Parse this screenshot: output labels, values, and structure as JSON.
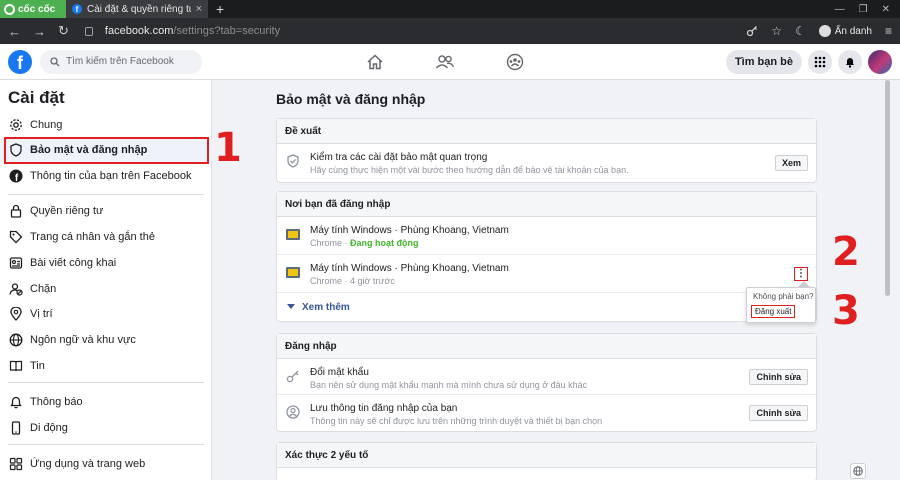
{
  "browser": {
    "brand": "cốc cốc",
    "tab_title": "Cài đặt & quyền riêng tư | Fa",
    "tab_close": "×",
    "new_tab": "+",
    "url_host": "facebook.com",
    "url_path": "/settings?tab=security",
    "incognito_label": "Ẩn danh",
    "window_controls": [
      "—",
      "❐",
      "✕"
    ]
  },
  "header": {
    "search_placeholder": "Tìm kiếm trên Facebook",
    "find_friends": "Tìm bạn bè"
  },
  "sidebar": {
    "title": "Cài đặt",
    "items": [
      {
        "label": "Chung",
        "icon": "gear-icon"
      },
      {
        "label": "Bảo mật và đăng nhập",
        "icon": "shield-icon",
        "active": true
      },
      {
        "label": "Thông tin của bạn trên Facebook",
        "icon": "facebook-icon"
      },
      {
        "label": "Quyền riêng tư",
        "icon": "lock-icon"
      },
      {
        "label": "Trang cá nhân và gắn thẻ",
        "icon": "tag-icon"
      },
      {
        "label": "Bài viết công khai",
        "icon": "public-posts-icon"
      },
      {
        "label": "Chặn",
        "icon": "block-icon"
      },
      {
        "label": "Vị trí",
        "icon": "location-pin-icon"
      },
      {
        "label": "Ngôn ngữ và khu vực",
        "icon": "globe-icon"
      },
      {
        "label": "Tin",
        "icon": "book-icon"
      },
      {
        "label": "Thông báo",
        "icon": "bell-icon"
      },
      {
        "label": "Di động",
        "icon": "mobile-icon"
      },
      {
        "label": "Ứng dụng và trang web",
        "icon": "apps-icon"
      }
    ]
  },
  "main": {
    "title": "Bảo mật và đăng nhập",
    "recommended": {
      "heading": "Đề xuất",
      "title": "Kiểm tra các cài đặt bảo mật quan trọng",
      "subtitle": "Hãy cùng thực hiện một vài bước theo hướng dẫn để bảo vệ tài khoản của bạn.",
      "button": "Xem"
    },
    "where_logged_in": {
      "heading": "Nơi bạn đã đăng nhập",
      "sessions": [
        {
          "device": "Máy tính Windows · Phùng Khoang, Vietnam",
          "browser": "Chrome · ",
          "status": "Đang hoạt động",
          "active": true
        },
        {
          "device": "Máy tính Windows · Phùng Khoang, Vietnam",
          "browser": "Chrome · ",
          "status": "4 giờ trước",
          "active": false
        }
      ],
      "see_more": "Xem thêm",
      "menu_button": "⋮"
    },
    "popup": {
      "question": "Không phải bạn?",
      "logout": "Đăng xuất"
    },
    "login": {
      "heading": "Đăng nhập",
      "rows": [
        {
          "title": "Đổi mật khẩu",
          "subtitle": "Bạn nên sử dụng mật khẩu mạnh mà mình chưa sử dụng ở đâu khác",
          "button": "Chỉnh sửa"
        },
        {
          "title": "Lưu thông tin đăng nhập của bạn",
          "subtitle": "Thông tin này sẽ chỉ được lưu trên những trình duyệt và thiết bị bạn chọn",
          "button": "Chỉnh sửa"
        }
      ]
    },
    "two_factor": {
      "heading": "Xác thực 2 yếu tố"
    }
  },
  "annotations": [
    "1",
    "2",
    "3"
  ],
  "colors": {
    "accent": "#1877f2",
    "annotation_red": "#e02020",
    "active_green": "#42b72a",
    "link_blue": "#365899"
  }
}
